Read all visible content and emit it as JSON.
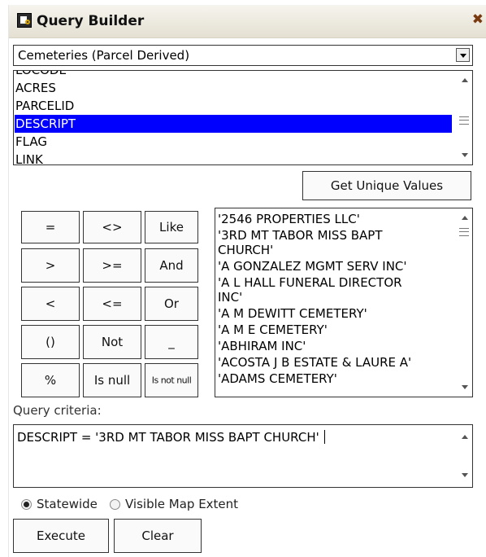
{
  "window": {
    "title": "Query Builder",
    "title_icon": "query-builder-icon",
    "close_icon": "close-icon"
  },
  "layer_select": {
    "selected": "Cemeteries (Parcel Derived)"
  },
  "fields": [
    {
      "label": "LOCODE",
      "selected": false
    },
    {
      "label": "ACRES",
      "selected": false
    },
    {
      "label": "PARCELID",
      "selected": false
    },
    {
      "label": "DESCRIPT",
      "selected": true
    },
    {
      "label": "FLAG",
      "selected": false
    },
    {
      "label": "LINK",
      "selected": false
    }
  ],
  "get_unique_values_label": "Get Unique Values",
  "operators": [
    [
      "=",
      "<>",
      "Like"
    ],
    [
      ">",
      ">=",
      "And"
    ],
    [
      "<",
      "<=",
      "Or"
    ],
    [
      "()",
      "Not",
      "_"
    ],
    [
      "%",
      "Is null",
      "Is not null"
    ]
  ],
  "unique_values": [
    "'2546 PROPERTIES LLC'",
    "'3RD MT TABOR MISS BAPT",
    "CHURCH'",
    "'A GONZALEZ MGMT SERV INC'",
    "'A L HALL FUNERAL DIRECTOR",
    "INC'",
    "'A M DEWITT CEMETERY'",
    "'A M E CEMETERY'",
    "'ABHIRAM INC'",
    "'ACOSTA J B ESTATE & LAURE A'",
    "'ADAMS CEMETERY'"
  ],
  "query_criteria_label": "Query criteria:",
  "query_text": "DESCRIPT  =  '3RD MT TABOR MISS BAPT CHURCH'",
  "extent": {
    "statewide_label": "Statewide",
    "visible_label": "Visible Map Extent",
    "selected": "Statewide"
  },
  "actions": {
    "execute_label": "Execute",
    "clear_label": "Clear"
  },
  "colors": {
    "selection": "#0000ff",
    "titlebar": "#ece9df"
  }
}
